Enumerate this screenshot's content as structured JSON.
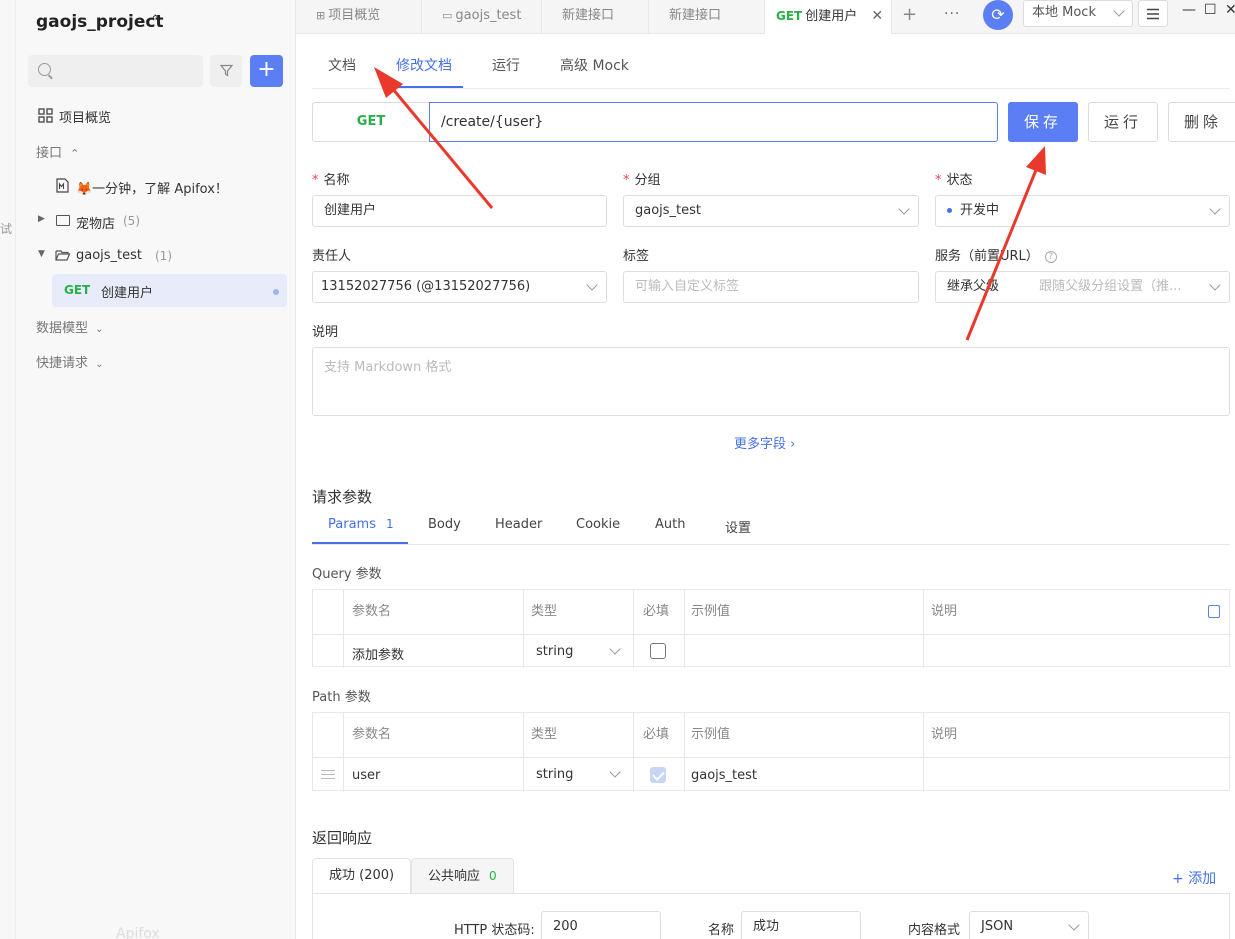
{
  "sidebar": {
    "edge_char": "试",
    "project_title": "gaojs_project",
    "project_chevron": "⌃",
    "items": [
      {
        "label": "项目概览"
      },
      {
        "label": "接口"
      },
      {
        "label": "🦊一分钟，了解 Apifox！"
      },
      {
        "label": "宠物店",
        "count": "(5)"
      },
      {
        "label": "gaojs_test",
        "count": "(1)"
      },
      {
        "method": "GET",
        "label": "创建用户"
      },
      {
        "label": "数据模型"
      },
      {
        "label": "快捷请求"
      }
    ],
    "footer_logo": "Apifox"
  },
  "tabs": [
    {
      "label": "项目概览"
    },
    {
      "label": "gaojs_test"
    },
    {
      "label": "新建接口"
    },
    {
      "label": "新建接口"
    },
    {
      "method": "GET",
      "label": "创建用户"
    }
  ],
  "env": {
    "selected": "本地 Mock"
  },
  "subtabs": [
    "文档",
    "修改文档",
    "运行",
    "高级 Mock"
  ],
  "request": {
    "method": "GET",
    "url": "/create/{user}",
    "save": "保存",
    "run": "运行",
    "delete": "删除"
  },
  "form": {
    "name_label": "名称",
    "name_value": "创建用户",
    "group_label": "分组",
    "group_value": "gaojs_test",
    "status_label": "状态",
    "status_value": "开发中",
    "owner_label": "责任人",
    "owner_value": "13152027756 (@13152027756)",
    "tags_label": "标签",
    "tags_placeholder": "可输入自定义标签",
    "service_label": "服务（前置URL）",
    "service_value": "继承父级",
    "service_hint": "跟随父级分组设置（推...",
    "desc_label": "说明",
    "desc_placeholder": "支持 Markdown 格式",
    "more_fields": "更多字段"
  },
  "params": {
    "title": "请求参数",
    "tabs": [
      {
        "label": "Params",
        "count": "1"
      },
      {
        "label": "Body"
      },
      {
        "label": "Header"
      },
      {
        "label": "Cookie"
      },
      {
        "label": "Auth"
      },
      {
        "label": "设置"
      }
    ],
    "columns": [
      "参数名",
      "类型",
      "必填",
      "示例值",
      "说明"
    ],
    "query_title": "Query 参数",
    "query_row": {
      "name_placeholder": "添加参数",
      "type": "string"
    },
    "path_title": "Path 参数",
    "path_row": {
      "name": "user",
      "type": "string",
      "required": true,
      "example": "gaojs_test"
    }
  },
  "response": {
    "title": "返回响应",
    "tabs": [
      {
        "label": "成功 (200)"
      },
      {
        "label": "公共响应",
        "count": "0"
      }
    ],
    "add": "添加",
    "http_code_label": "HTTP 状态码:",
    "http_code_value": "200",
    "name_label": "名称",
    "name_value": "成功",
    "format_label": "内容格式",
    "format_value": "JSON"
  },
  "colors": {
    "accent": "#5b7ef5",
    "get": "#27b148",
    "annotation": "#e8392c"
  }
}
